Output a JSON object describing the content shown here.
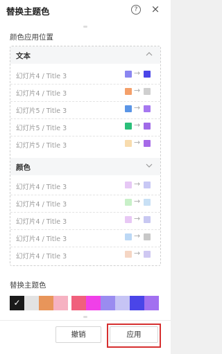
{
  "header": {
    "title": "替换主题色",
    "help_glyph": "?",
    "close_glyph": "×"
  },
  "color_positions": {
    "label": "颜色应用位置",
    "groups": [
      {
        "name": "文本",
        "expanded": true,
        "rows": [
          {
            "label": "幻灯片4 / Title 3",
            "from": "#8a86f0",
            "to": "#4a45e8"
          },
          {
            "label": "幻灯片4 / Title 3",
            "from": "#f4a06a",
            "to": "#cfcfcf"
          },
          {
            "label": "幻灯片5 / Title 3",
            "from": "#5b95e6",
            "to": "#a678f0"
          },
          {
            "label": "幻灯片5 / Title 3",
            "from": "#2bbf7a",
            "to": "#a06ae8"
          },
          {
            "label": "幻灯片5 / Title 3",
            "from": "#f8dcae",
            "to": "#a66ae8"
          }
        ]
      },
      {
        "name": "颜色",
        "expanded": false,
        "rows": [
          {
            "label": "幻灯片4 / Title 3",
            "from": "#e6c8f5",
            "to": "#c8c8f5"
          },
          {
            "label": "幻灯片4 / Title 3",
            "from": "#c8f0c8",
            "to": "#c8e0f5"
          },
          {
            "label": "幻灯片4 / Title 3",
            "from": "#e8c8f5",
            "to": "#c8c8f2"
          },
          {
            "label": "幻灯片4 / Title 3",
            "from": "#bcd8f5",
            "to": "#c8c8c8"
          },
          {
            "label": "幻灯片4 / Title 3",
            "from": "#f5d6c4",
            "to": "#cfc8f2"
          }
        ]
      }
    ]
  },
  "replace": {
    "label": "替换主题色",
    "check_glyph": "✓",
    "swatches": [
      "#1a1a1a",
      "#e3e3e3",
      "#e8955a",
      "#f6b2c2",
      "#f0607c",
      "#f040e8",
      "#9a8cf0",
      "#c6c4f5",
      "#4a45e8",
      "#a270f0"
    ]
  },
  "footer": {
    "cancel_label": "撤销",
    "apply_label": "应用"
  }
}
